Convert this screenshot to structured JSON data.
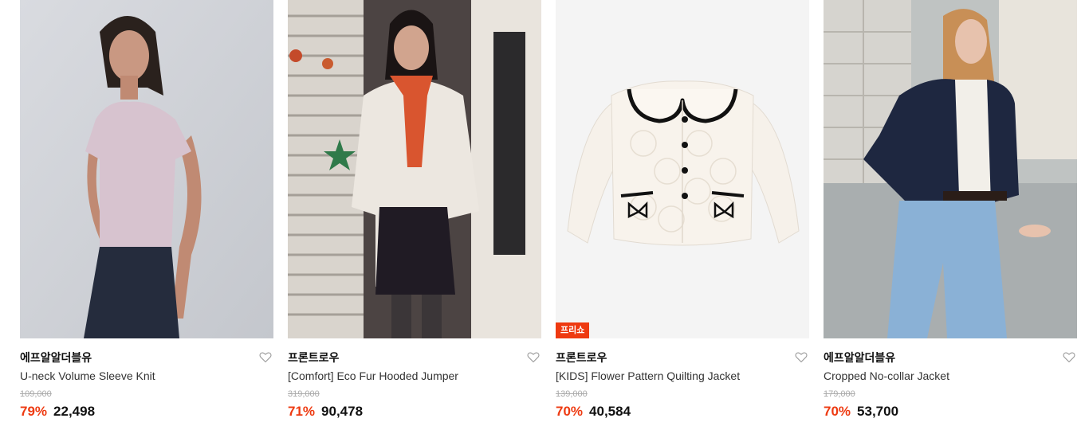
{
  "products": [
    {
      "brand": "에프알알더블유",
      "name": "U-neck Volume Sleeve Knit",
      "original_price": "109,000",
      "discount": "79%",
      "price": "22,498",
      "badge": null
    },
    {
      "brand": "프론트로우",
      "name": "[Comfort] Eco Fur Hooded Jumper",
      "original_price": "319,000",
      "discount": "71%",
      "price": "90,478",
      "badge": null
    },
    {
      "brand": "프론트로우",
      "name": "[KIDS] Flower Pattern Quilting Jacket",
      "original_price": "139,000",
      "discount": "70%",
      "price": "40,584",
      "badge": "프리쇼"
    },
    {
      "brand": "에프알알더블유",
      "name": "Cropped No-collar Jacket",
      "original_price": "179,000",
      "discount": "70%",
      "price": "53,700",
      "badge": null
    }
  ],
  "colors": {
    "accent": "#ee3a11",
    "text": "#111111",
    "muted": "#aaaaaa"
  },
  "icons": {
    "wishlist": "heart-outline-icon"
  }
}
